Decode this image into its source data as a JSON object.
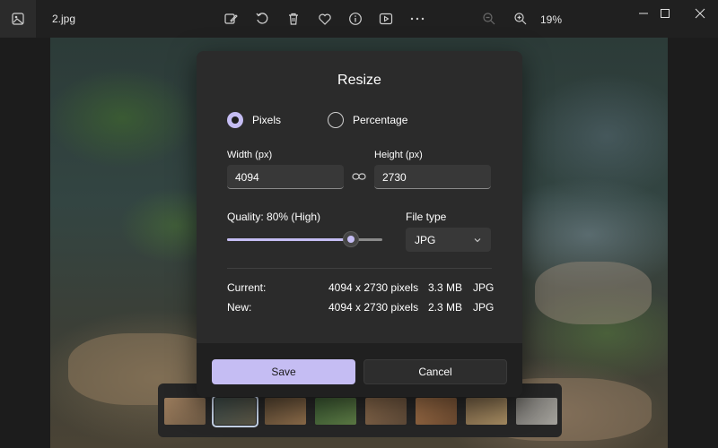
{
  "titlebar": {
    "filename": "2.jpg",
    "zoom_level": "19%",
    "icons": [
      "edit-image-icon",
      "rotate-icon",
      "delete-icon",
      "favorite-icon",
      "info-icon",
      "slideshow-icon",
      "more-icon",
      "zoom-out-icon",
      "zoom-in-icon"
    ]
  },
  "dialog": {
    "title": "Resize",
    "mode_pixels": "Pixels",
    "mode_percentage": "Percentage",
    "selected_mode": "pixels",
    "width_label": "Width  (px)",
    "height_label": "Height  (px)",
    "width_value": "4094",
    "height_value": "2730",
    "quality_label": "Quality: 80% (High)",
    "quality_percent": 80,
    "filetype_label": "File type",
    "filetype_value": "JPG",
    "current": {
      "label": "Current:",
      "dimensions": "4094 x 2730 pixels",
      "size": "3.3 MB",
      "format": "JPG"
    },
    "new": {
      "label": "New:",
      "dimensions": "4094 x 2730 pixels",
      "size": "2.3 MB",
      "format": "JPG"
    },
    "save_label": "Save",
    "cancel_label": "Cancel"
  },
  "colors": {
    "accent": "#c5bdf3",
    "dialog_bg": "#2b2b2b",
    "titlebar_bg": "#202020"
  },
  "filmstrip": {
    "selected_index": 1
  }
}
